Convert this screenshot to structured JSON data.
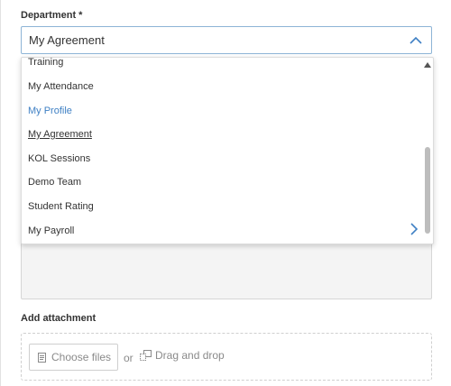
{
  "department": {
    "label": "Department *",
    "selected_value": "My Agreement",
    "options": [
      "Training",
      "My Attendance",
      "My Profile",
      "My Agreement",
      "KOL Sessions",
      "Demo Team",
      "Student Rating",
      "My Payroll"
    ],
    "active_option": "My Profile",
    "hovered_option": "My Agreement"
  },
  "attachment": {
    "label": "Add attachment",
    "choose_files_label": "Choose files",
    "or_text": "or",
    "drag_drop_label": "Drag and drop"
  },
  "colors": {
    "accent": "#3f80c4",
    "select_border": "#8db4d6",
    "scroll_thumb": "#bdbdbd"
  },
  "icons": {
    "select_toggle": "chevron-up-icon",
    "submenu": "chevron-right-icon",
    "scroll_up": "triangle-up-icon",
    "choose_files": "file-icon",
    "drag_drop": "copy-icon"
  }
}
